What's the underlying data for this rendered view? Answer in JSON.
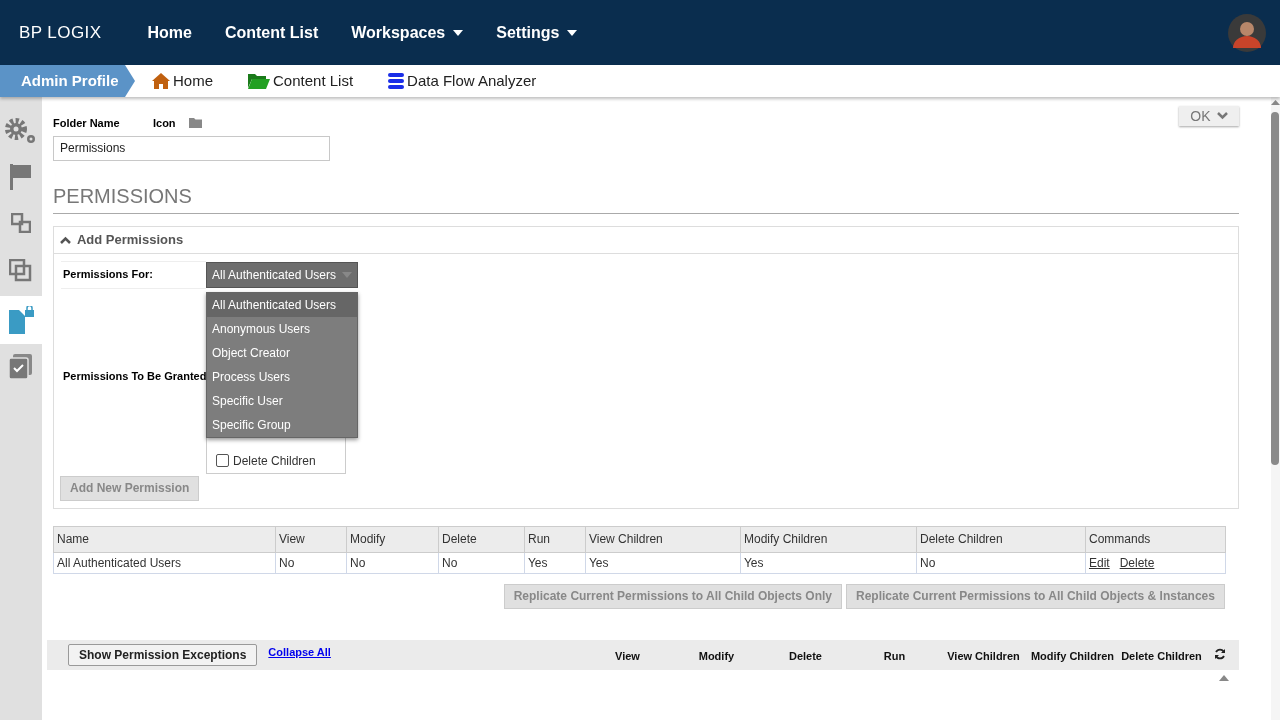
{
  "topnav": {
    "logo": "BP LOGIX",
    "items": [
      {
        "label": "Home",
        "dropdown": false
      },
      {
        "label": "Content List",
        "dropdown": false
      },
      {
        "label": "Workspaces",
        "dropdown": true
      },
      {
        "label": "Settings",
        "dropdown": true
      }
    ]
  },
  "breadcrumb": {
    "profile": "Admin Profile",
    "links": [
      {
        "label": "Home",
        "kind": "home"
      },
      {
        "label": "Content List",
        "kind": "folder"
      },
      {
        "label": "Data Flow Analyzer",
        "kind": "database"
      }
    ]
  },
  "sidebar": {
    "items": [
      {
        "selected": false
      },
      {
        "selected": false
      },
      {
        "selected": false
      },
      {
        "selected": false
      },
      {
        "selected": true
      },
      {
        "selected": false
      }
    ]
  },
  "ok_button": "OK",
  "folder": {
    "name_label": "Folder Name",
    "icon_label": "Icon",
    "name_value": "Permissions"
  },
  "section_title": "PERMISSIONS",
  "add_permissions": {
    "title": "Add Permissions",
    "expanded": true,
    "for_label": "Permissions For:",
    "granted_label": "Permissions To Be Granted",
    "select": {
      "value": "All Authenticated Users",
      "expanded": true,
      "options": [
        {
          "label": "All Authenticated Users",
          "selected": true
        },
        {
          "label": "Anonymous Users",
          "selected": false
        },
        {
          "label": "Object Creator",
          "selected": false
        },
        {
          "label": "Process Users",
          "selected": false
        },
        {
          "label": "Specific User",
          "selected": false
        },
        {
          "label": "Specific Group",
          "selected": false
        }
      ]
    },
    "checkboxes": [
      {
        "label": "Delete Children",
        "checked": false
      }
    ],
    "add_button": "Add New Permission"
  },
  "table": {
    "columns": [
      "Name",
      "View",
      "Modify",
      "Delete",
      "Run",
      "View Children",
      "Modify Children",
      "Delete Children",
      "Commands"
    ],
    "rows": [
      {
        "cells": [
          "All Authenticated Users",
          "No",
          "No",
          "No",
          "Yes",
          "Yes",
          "Yes",
          "No"
        ],
        "commands": [
          "Edit",
          "Delete"
        ]
      }
    ]
  },
  "replicate_buttons": [
    "Replicate Current Permissions to All Child Objects Only",
    "Replicate Current Permissions to All Child Objects & Instances"
  ],
  "exceptions": {
    "button": "Show Permission Exceptions",
    "link": "Collapse All",
    "columns": [
      "View",
      "Modify",
      "Delete",
      "Run",
      "View Children",
      "Modify Children",
      "Delete Children"
    ]
  }
}
